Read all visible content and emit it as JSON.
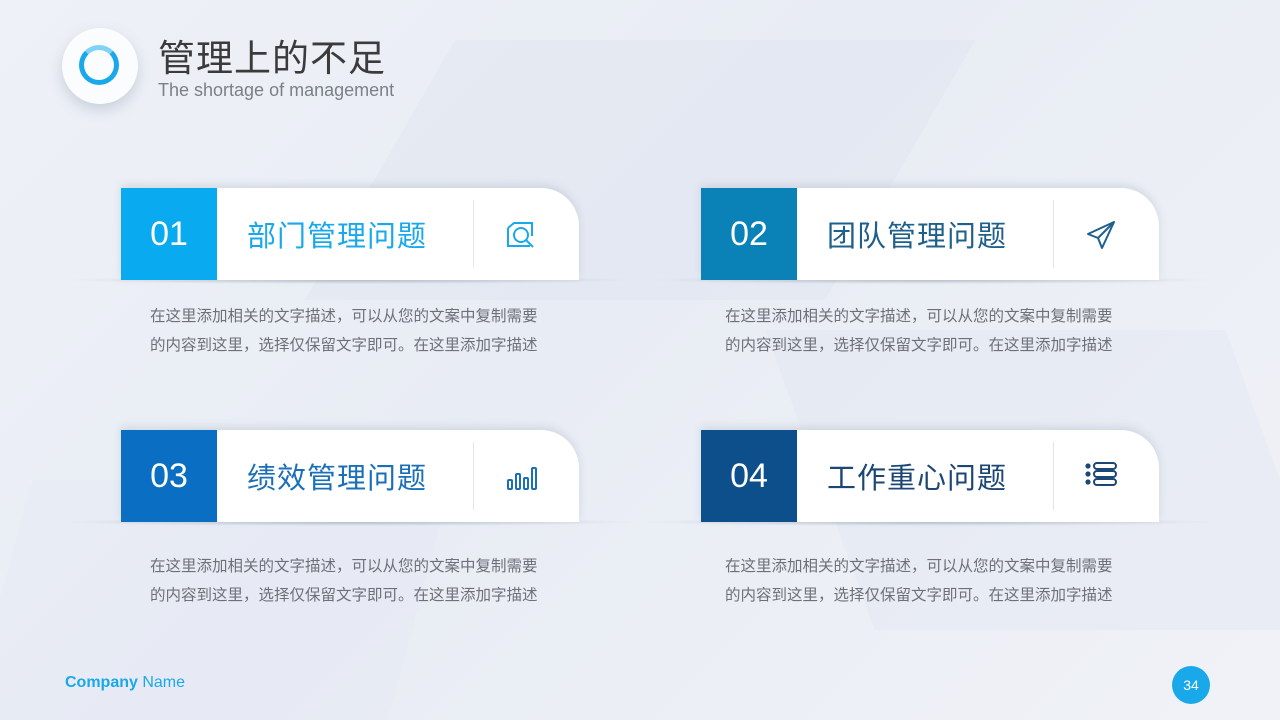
{
  "header": {
    "title": "管理上的不足",
    "subtitle": "The shortage of management"
  },
  "cards": [
    {
      "number": "01",
      "label": "部门管理问题",
      "icon": "search-document-icon",
      "accent": "#0aaaf0",
      "label_color": "#19a9ea",
      "description": [
        "在这里添加相关的文字描述，可以从您的文案中复制需要",
        "的内容到这里，选择仅保留文字即可。在这里添加字描述"
      ]
    },
    {
      "number": "02",
      "label": "团队管理问题",
      "icon": "paper-plane-icon",
      "accent": "#0a81b7",
      "label_color": "#1f5f8b",
      "description": [
        "在这里添加相关的文字描述，可以从您的文案中复制需要",
        "的内容到这里，选择仅保留文字即可。在这里添加字描述"
      ]
    },
    {
      "number": "03",
      "label": "绩效管理问题",
      "icon": "bar-chart-icon",
      "accent": "#0a6fc2",
      "label_color": "#1a6fb8",
      "description": [
        "在这里添加相关的文字描述，可以从您的文案中复制需要",
        "的内容到这里，选择仅保留文字即可。在这里添加字描述"
      ]
    },
    {
      "number": "04",
      "label": "工作重心问题",
      "icon": "list-icon",
      "accent": "#0d4f8a",
      "label_color": "#1c4673",
      "description": [
        "在这里添加相关的文字描述，可以从您的文案中复制需要",
        "的内容到这里，选择仅保留文字即可。在这里添加字描述"
      ]
    }
  ],
  "footer": {
    "company_bold": "Company",
    "company_rest": " Name",
    "page_number": "34"
  },
  "colors": {
    "brand": "#19a9ea"
  }
}
